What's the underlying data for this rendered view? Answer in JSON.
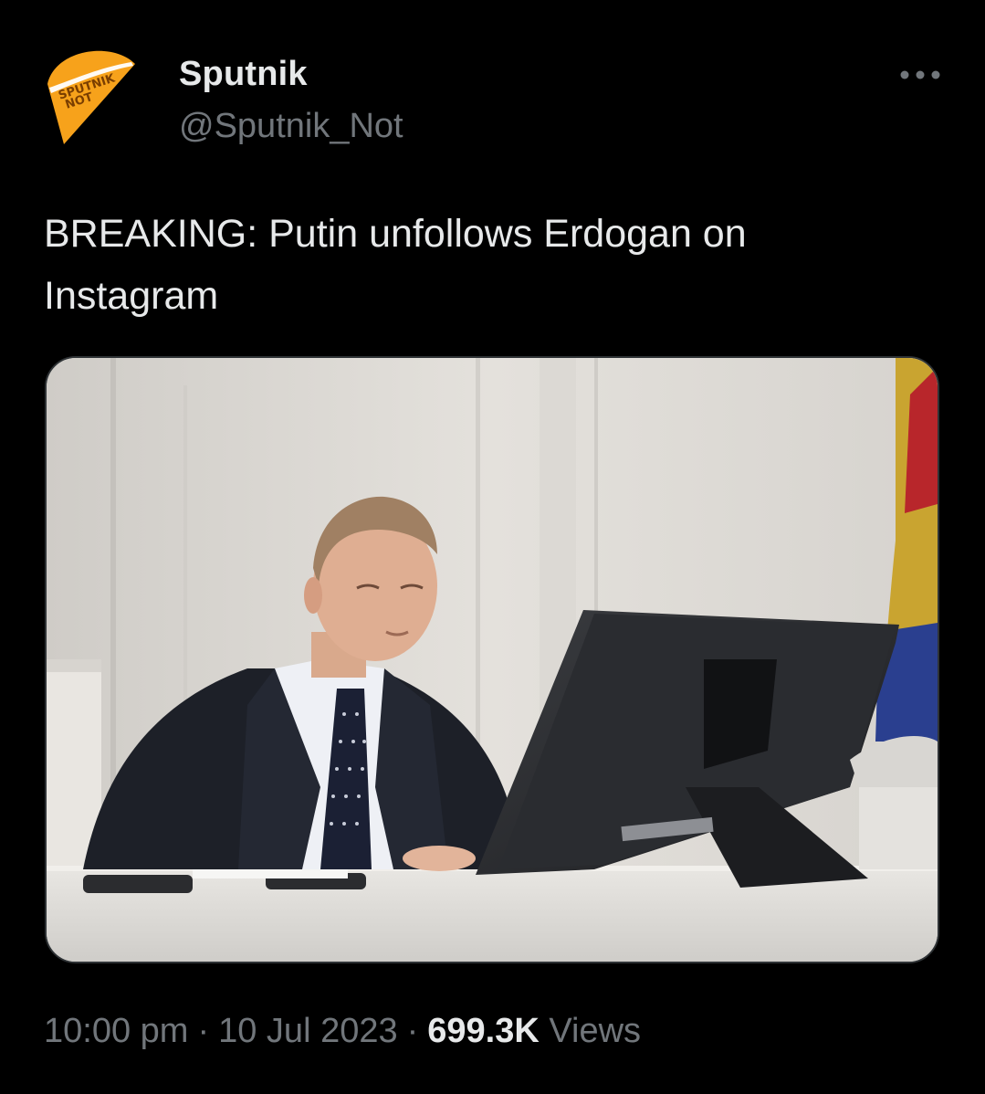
{
  "author": {
    "display_name": "Sputnik",
    "handle": "@Sputnik_Not",
    "avatar_icon": "sputnik-not-logo",
    "avatar_logo_text": [
      "SPUTNIK",
      "NOT"
    ],
    "avatar_color": "#f7a21b"
  },
  "menu": {
    "more_icon": "more-dots-icon"
  },
  "tweet": {
    "text_line1": "BREAKING: Putin unfollows Erdogan on",
    "text_line2": "Instagram"
  },
  "media": {
    "kind": "photo",
    "depicts": "man in suit seated at desk looking at a computer monitor"
  },
  "meta": {
    "time": "10:00 pm",
    "separator": "·",
    "date": "10 Jul 2023",
    "views_count": "699.3K",
    "views_label": "Views"
  },
  "colors": {
    "background": "#000000",
    "primary_text": "#e7e9ea",
    "secondary_text": "#71767b",
    "border": "#2f3336"
  }
}
